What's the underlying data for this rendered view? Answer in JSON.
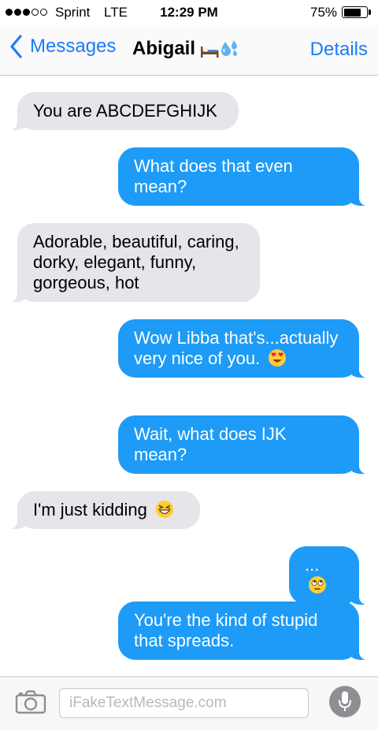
{
  "status_bar": {
    "carrier": "Sprint",
    "network": "LTE",
    "time": "12:29 PM",
    "battery_percent": "75%",
    "battery_level": 0.75,
    "signal_bars_filled": 3,
    "signal_bars_total": 5
  },
  "nav": {
    "back_label": "Messages",
    "contact_name": "Abigail",
    "contact_emoji_icons": [
      "bed-icon",
      "sweat-droplets-icon"
    ],
    "details_label": "Details"
  },
  "messages": [
    {
      "direction": "incoming",
      "text": "You are ABCDEFGHIJK"
    },
    {
      "direction": "outgoing",
      "text": "What does that even mean?"
    },
    {
      "direction": "incoming",
      "text": "Adorable, beautiful, caring, dorky, elegant, funny, gorgeous, hot"
    },
    {
      "direction": "outgoing",
      "text": "Wow Libba that's...actually very nice of you.",
      "emoji": "heart-eyes-emoji-icon"
    },
    {
      "direction": "outgoing",
      "text": "Wait, what does IJK mean?"
    },
    {
      "direction": "incoming",
      "text": "I'm just kidding",
      "emoji": "grinning-squinting-emoji-icon"
    },
    {
      "direction": "outgoing",
      "text": "...",
      "emoji": "eye-roll-emoji-icon"
    },
    {
      "direction": "outgoing",
      "text": "You're the kind of stupid that spreads."
    }
  ],
  "input": {
    "placeholder": "iFakeTextMessage.com",
    "value": ""
  },
  "colors": {
    "ios_blue": "#1a7cf9",
    "outgoing_bubble": "#1d9bf6",
    "incoming_bubble": "#e5e5ea"
  }
}
